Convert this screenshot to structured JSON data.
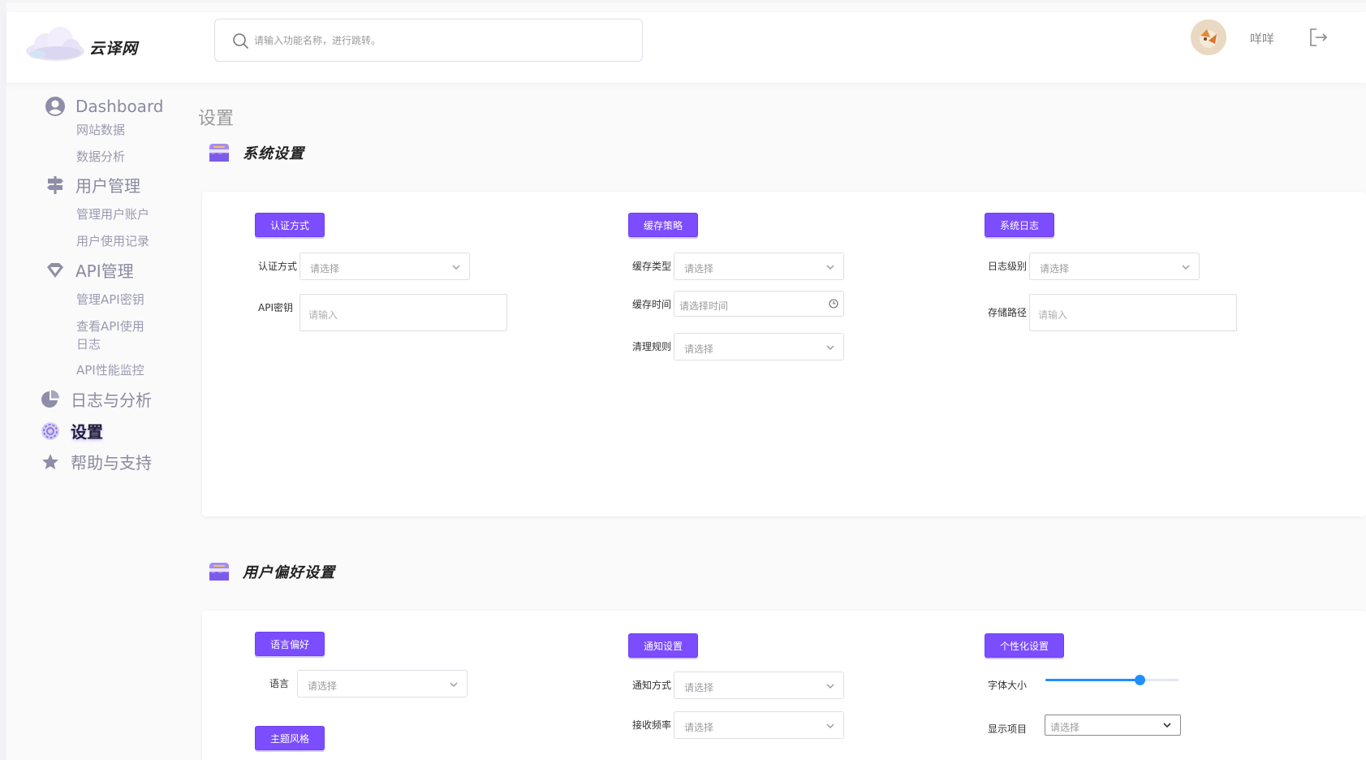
{
  "brand": {
    "name": "云译网"
  },
  "search": {
    "placeholder": "请输入功能名称，进行跳转。"
  },
  "user": {
    "name": "咩咩"
  },
  "sidebar": {
    "groups": [
      {
        "label": "Dashboard",
        "icon": "user-circle-icon",
        "items": [
          "网站数据",
          "数据分析"
        ]
      },
      {
        "label": "用户管理",
        "icon": "signpost-icon",
        "items": [
          "管理用户账户",
          "用户使用记录"
        ]
      },
      {
        "label": "API管理",
        "icon": "diamond-icon",
        "items": [
          "管理API密钥",
          "查看API使用日志",
          "API性能监控"
        ]
      },
      {
        "label": "日志与分析",
        "icon": "pie-chart-icon",
        "items": []
      },
      {
        "label": "设置",
        "icon": "gear-icon",
        "items": [],
        "active": true
      },
      {
        "label": "帮助与支持",
        "icon": "star-icon",
        "items": []
      }
    ],
    "sub_api_log_line1": "查看API使用",
    "sub_api_log_line2": "日志"
  },
  "main": {
    "page_title": "设置",
    "system": {
      "title": "系统设置",
      "auth": {
        "tag": "认证方式",
        "method_label": "认证方式",
        "method_placeholder": "请选择",
        "key_label": "API密钥",
        "key_placeholder": "请输入"
      },
      "cache": {
        "tag": "缓存策略",
        "type_label": "缓存类型",
        "type_placeholder": "请选择",
        "time_label": "缓存时间",
        "time_placeholder": "请选择时间",
        "rule_label": "清理规则",
        "rule_placeholder": "请选择"
      },
      "log": {
        "tag": "系统日志",
        "level_label": "日志级别",
        "level_placeholder": "请选择",
        "path_label": "存储路径",
        "path_placeholder": "请输入"
      }
    },
    "prefs": {
      "title": "用户偏好设置",
      "language": {
        "tag": "语言偏好",
        "label": "语言",
        "placeholder": "请选择"
      },
      "theme": {
        "tag": "主题风格"
      },
      "notify": {
        "tag": "通知设置",
        "method_label": "通知方式",
        "method_placeholder": "请选择",
        "freq_label": "接收频率",
        "freq_placeholder": "请选择"
      },
      "personal": {
        "tag": "个性化设置",
        "font_label": "字体大小",
        "font_size_fraction": 0.71,
        "items_label": "显示项目",
        "items_placeholder": "请选择"
      }
    }
  },
  "colors": {
    "accent": "#7c4dff",
    "slider": "#1e8fff"
  }
}
